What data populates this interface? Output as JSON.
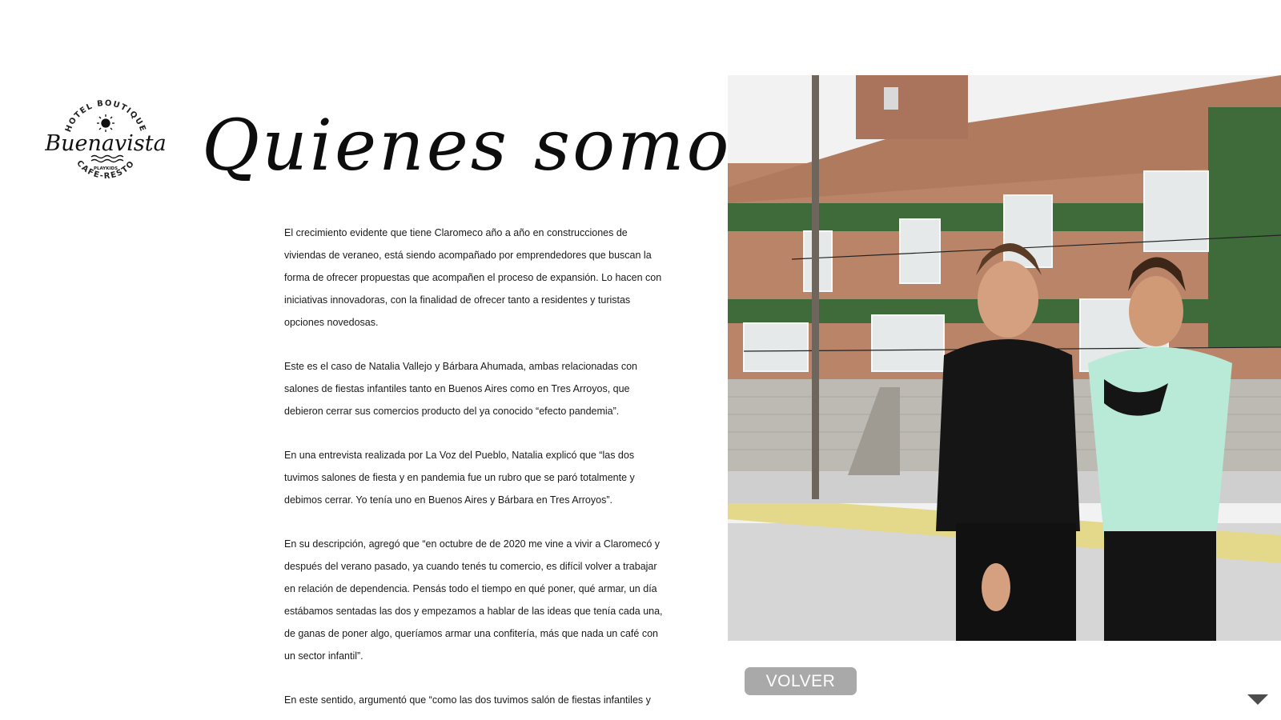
{
  "logo": {
    "top_text": "HOTEL BOUTIQUE",
    "script_text": "Buenavista",
    "small_text": "PLAYKIDS",
    "bottom_text": "CAFE-RESTO"
  },
  "heading": "Quienes somos",
  "article": {
    "paragraphs": [
      "El crecimiento evidente que tiene Claromeco año a año en construcciones de viviendas de veraneo, está siendo acompañado por emprendedores que buscan la forma de ofrecer propuestas que acompañen el proceso de expansión. Lo hacen con iniciativas innovadoras, con la finalidad de ofrecer tanto a residentes y turistas opciones novedosas.",
      "Este es el caso de Natalia Vallejo y Bárbara Ahumada, ambas relacionadas con salones de fiestas infantiles tanto en Buenos Aires como en Tres Arroyos, que debieron cerrar sus comercios producto del ya conocido “efecto pandemia”.",
      "En una entrevista realizada por La Voz del Pueblo, Natalia explicó que “las dos tuvimos salones de fiesta y en pandemia fue un rubro que se paró totalmente y debimos cerrar. Yo tenía uno en Buenos Aires y Bárbara en Tres Arroyos”.",
      "En su descripción, agregó que “en octubre de de 2020 me vine a vivir a Claromecó y después del verano pasado, ya cuando tenés tu comercio, es difícil volver a trabajar en relación de dependencia. Pensás todo el tiempo en qué poner, qué armar, un día estábamos sentadas las dos y empezamos a hablar de las ideas que tenía cada una, de ganas de poner algo, queríamos armar una confitería, más que nada un café con un sector infantil”.",
      "En este sentido, argumentó que “como las dos tuvimos salón de fiestas infantiles y nos"
    ]
  },
  "photo": {
    "icon": "photo-two-women-hotel"
  },
  "volver_label": "VOLVER",
  "colors": {
    "button_bg": "#a9a9a9",
    "button_text": "#ffffff",
    "heading": "#0d0d0d",
    "building_green": "#3f6b3a",
    "brick": "#b98468"
  }
}
